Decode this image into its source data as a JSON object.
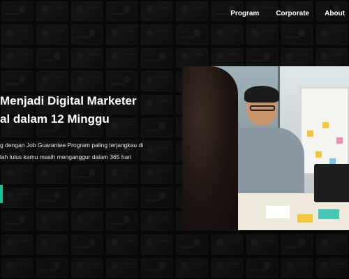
{
  "nav": {
    "items": [
      {
        "label": "Program"
      },
      {
        "label": "Corporate"
      },
      {
        "label": "About"
      }
    ]
  },
  "hero": {
    "title_line1": "Menjadi Digital Marketer",
    "title_line2": "al dalam 12 Minggu",
    "desc_line1": "g dengan Job Guarantee Program paling terjangkau di",
    "desc_line2": "lah lulus kamu masih menganggur dalam 365 hari"
  },
  "colors": {
    "accent": "#15c39a",
    "background": "#0b0b0b",
    "text": "#ffffff"
  }
}
